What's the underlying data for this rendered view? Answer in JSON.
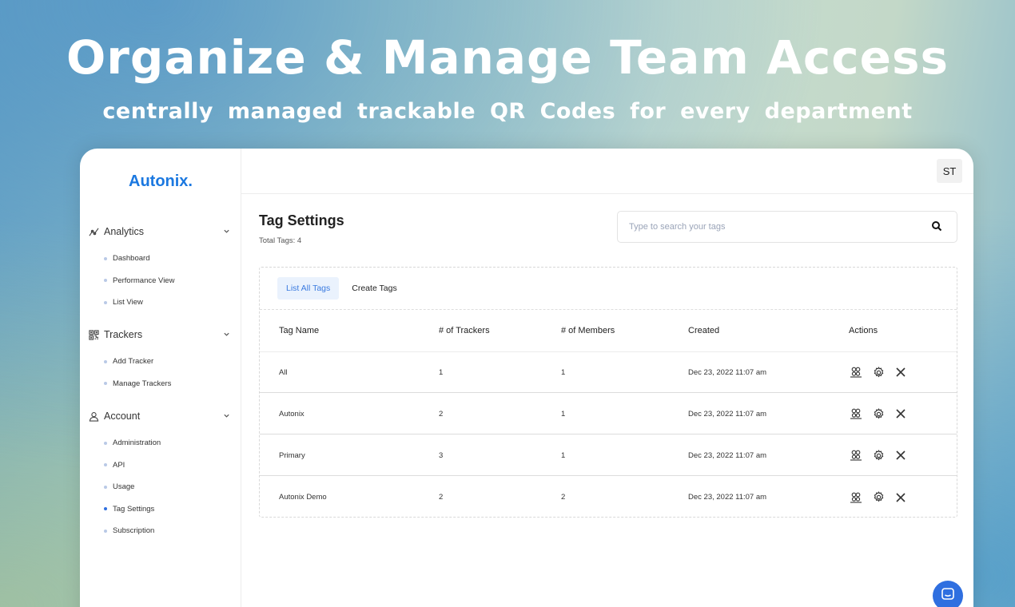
{
  "hero": {
    "title": "Organize & Manage Team Access",
    "subtitle": "centrally managed trackable QR Codes for every department"
  },
  "app": {
    "logo": "Autonix.",
    "avatar_initials": "ST"
  },
  "sidebar": {
    "groups": [
      {
        "label": "Analytics",
        "icon": "analytics-icon",
        "items": [
          "Dashboard",
          "Performance View",
          "List View"
        ]
      },
      {
        "label": "Trackers",
        "icon": "qr-code-icon",
        "items": [
          "Add Tracker",
          "Manage Trackers"
        ]
      },
      {
        "label": "Account",
        "icon": "user-icon",
        "items": [
          "Administration",
          "API",
          "Usage",
          "Tag Settings",
          "Subscription"
        ]
      }
    ],
    "active_item": "Tag Settings"
  },
  "main": {
    "title": "Tag Settings",
    "total_tags": "Total Tags: 4",
    "search_placeholder": "Type to search your tags",
    "tabs": [
      "List All Tags",
      "Create Tags"
    ],
    "active_tab": "List All Tags",
    "columns": [
      "Tag Name",
      "# of Trackers",
      "# of Members",
      "Created",
      "Actions"
    ],
    "rows": [
      {
        "name": "All",
        "trackers": "1",
        "members": "1",
        "created": "Dec 23, 2022 11:07 am"
      },
      {
        "name": "Autonix",
        "trackers": "2",
        "members": "1",
        "created": "Dec 23, 2022 11:07 am"
      },
      {
        "name": "Primary",
        "trackers": "3",
        "members": "1",
        "created": "Dec 23, 2022 11:07 am"
      },
      {
        "name": "Autonix Demo",
        "trackers": "2",
        "members": "2",
        "created": "Dec 23, 2022 11:07 am"
      }
    ],
    "row_actions": [
      "members-icon",
      "gear-icon",
      "close-icon"
    ]
  },
  "colors": {
    "brand": "#1b78e0",
    "active_tab_bg": "#eaf2fd",
    "chat_button": "#2f6fe0"
  }
}
